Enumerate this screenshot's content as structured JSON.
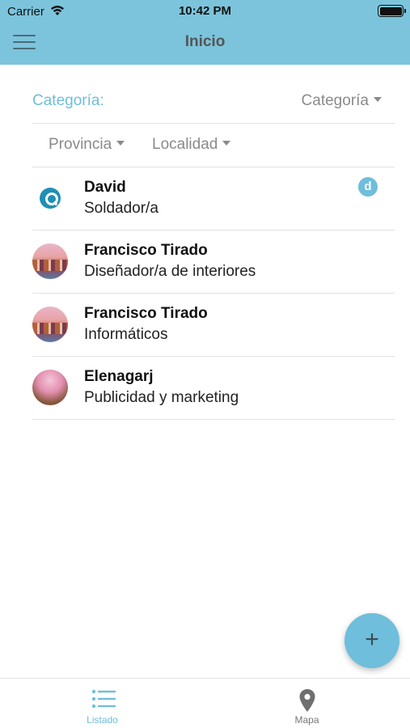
{
  "status_bar": {
    "carrier": "Carrier",
    "time": "10:42 PM",
    "battery_level": 1.0
  },
  "header": {
    "title": "Inicio",
    "menu_icon": "hamburger-icon"
  },
  "filters": {
    "category_label": "Categoría:",
    "category_dropdown": "Categoría",
    "province_dropdown": "Provincia",
    "locality_dropdown": "Localidad"
  },
  "items": [
    {
      "name": "David",
      "subtitle": "Soldador/a",
      "avatar": "logo-avatar",
      "badge": "d"
    },
    {
      "name": "Francisco Tirado",
      "subtitle": "Diseñador/a de interiores",
      "avatar": "city-photo-avatar"
    },
    {
      "name": "Francisco Tirado",
      "subtitle": "Informáticos",
      "avatar": "city-photo-avatar"
    },
    {
      "name": "Elenagarj",
      "subtitle": "Publicidad y marketing",
      "avatar": "nails-photo-avatar"
    }
  ],
  "fab": {
    "label": "+"
  },
  "tabs": [
    {
      "label": "Listado",
      "icon": "list-icon",
      "active": true
    },
    {
      "label": "Mapa",
      "icon": "map-pin-icon",
      "active": false
    }
  ],
  "colors": {
    "accent": "#6fbedb",
    "header_bg": "#7cc4dc",
    "divider": "#e3e3e3"
  }
}
